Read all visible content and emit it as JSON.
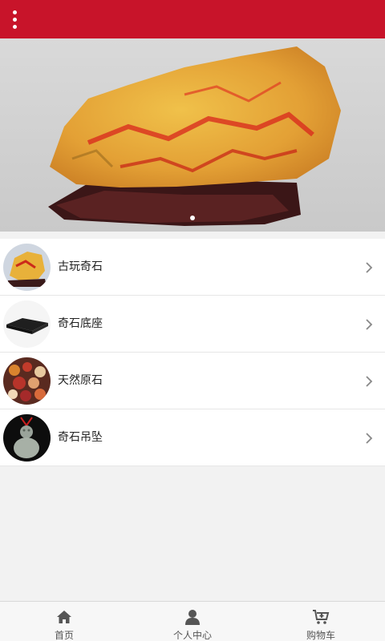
{
  "header": {
    "menu_icon": "more-vertical-icon"
  },
  "banner": {
    "image": "rock-specimen-on-stand",
    "active_slide": 1,
    "slide_count": 1
  },
  "categories": [
    {
      "label": "古玩奇石",
      "icon": "chevron-right-icon"
    },
    {
      "label": "奇石底座",
      "icon": "chevron-right-icon"
    },
    {
      "label": "天然原石",
      "icon": "chevron-right-icon"
    },
    {
      "label": "奇石吊坠",
      "icon": "chevron-right-icon"
    }
  ],
  "tabbar": {
    "tabs": [
      {
        "label": "首页",
        "icon": "home-icon"
      },
      {
        "label": "个人中心",
        "icon": "user-icon"
      },
      {
        "label": "购物车",
        "icon": "cart-icon"
      }
    ]
  },
  "colors": {
    "accent": "#c8142a",
    "background": "#f2f2f2"
  }
}
